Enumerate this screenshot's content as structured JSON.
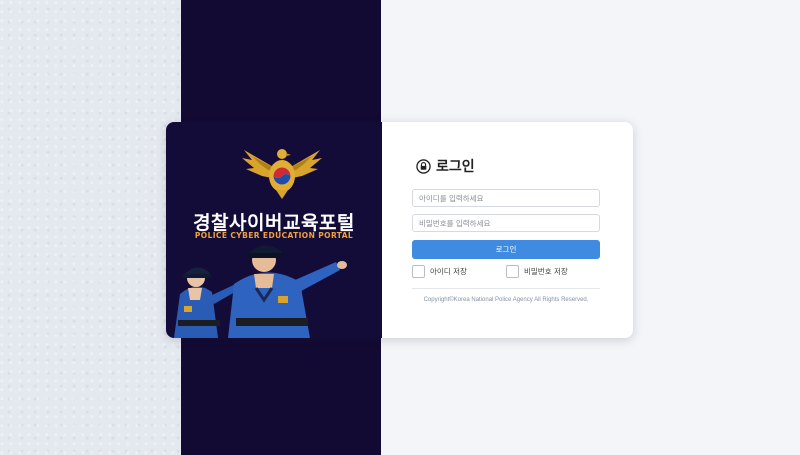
{
  "hero": {
    "title": "경찰사이버교육포털",
    "subtitle": "POLICE CYBER EDUCATION PORTAL",
    "emblem_icon": "police-eagle-emblem-icon"
  },
  "login": {
    "title": "로그인",
    "lock_icon": "lock-icon",
    "id_placeholder": "아이디를 입력하세요",
    "pw_placeholder": "비밀번호를 입력하세요",
    "submit_label": "로그인",
    "save_id_label": "아이디 저장",
    "save_pw_label": "비밀번호 저장",
    "copyright": "Copyright©Korea National Police Agency All Rights Reserved."
  },
  "colors": {
    "band": "#120a33",
    "button": "#3e8be1",
    "emblem_gold": "#d9a42b",
    "subtitle_orange": "#f2a03a",
    "uniform_blue": "#2a5bb5"
  }
}
